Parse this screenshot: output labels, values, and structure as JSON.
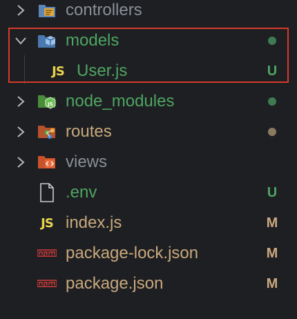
{
  "colors": {
    "background": "#1e1f22",
    "untracked_green": "#4ea562",
    "modified_tan": "#c8a97e",
    "folder_default": "#8a8f98",
    "highlight_border": "#d93a2b",
    "js_yellow": "#e8d44d",
    "npm_red": "#cc3b3b"
  },
  "explorer": {
    "items": [
      {
        "label": "controllers",
        "kind": "folder",
        "icon": "controllers-folder-icon",
        "chevron": "chevron-right-icon",
        "status": "",
        "label_color": "#8a8f98"
      },
      {
        "label": "models",
        "kind": "folder",
        "icon": "models-folder-icon",
        "chevron": "chevron-down-icon",
        "status": "dot",
        "status_color": "#3f7a52",
        "label_color": "#4ea562"
      },
      {
        "label": "User.js",
        "kind": "file",
        "icon": "js-file-icon",
        "status": "U",
        "status_color": "#4ea562",
        "label_color": "#4ea562"
      },
      {
        "label": "node_modules",
        "kind": "folder",
        "icon": "node-modules-folder-icon",
        "chevron": "chevron-right-icon",
        "status": "dot",
        "status_color": "#3f7a52",
        "label_color": "#4ea562"
      },
      {
        "label": "routes",
        "kind": "folder",
        "icon": "routes-folder-icon",
        "chevron": "chevron-right-icon",
        "status": "dot",
        "status_color": "#8a7a62",
        "label_color": "#c8a97e"
      },
      {
        "label": "views",
        "kind": "folder",
        "icon": "views-folder-icon",
        "chevron": "chevron-right-icon",
        "status": "",
        "label_color": "#8a8f98"
      },
      {
        "label": ".env",
        "kind": "file",
        "icon": "env-file-icon",
        "status": "U",
        "status_color": "#4ea562",
        "label_color": "#4ea562"
      },
      {
        "label": "index.js",
        "kind": "file",
        "icon": "js-file-icon",
        "status": "M",
        "status_color": "#c8a97e",
        "label_color": "#c8a97e"
      },
      {
        "label": "package-lock.json",
        "kind": "file",
        "icon": "npm-file-icon",
        "status": "M",
        "status_color": "#c8a97e",
        "label_color": "#c8a97e"
      },
      {
        "label": "package.json",
        "kind": "file",
        "icon": "npm-file-icon",
        "status": "M",
        "status_color": "#c8a97e",
        "label_color": "#c8a97e"
      }
    ],
    "js_icon_text": "JS"
  }
}
